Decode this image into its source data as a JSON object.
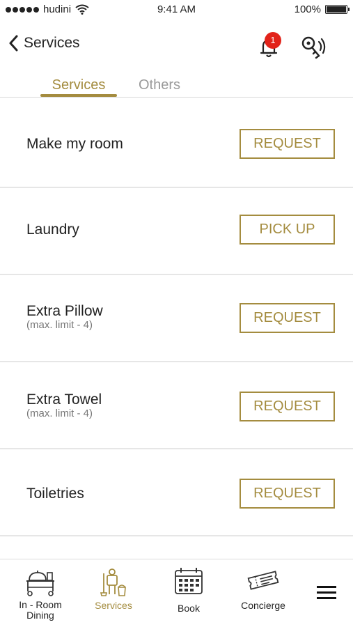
{
  "status_bar": {
    "carrier": "hudini",
    "time": "9:41 AM",
    "battery": "100%"
  },
  "header": {
    "back_label": "Services",
    "notification_count": "1"
  },
  "tabs": [
    {
      "label": "Services",
      "active": true
    },
    {
      "label": "Others",
      "active": false
    }
  ],
  "services": [
    {
      "title": "Make my room",
      "subtitle": "",
      "action": "REQUEST"
    },
    {
      "title": "Laundry",
      "subtitle": "",
      "action": "PICK UP"
    },
    {
      "title": "Extra Pillow",
      "subtitle": "(max. limit - 4)",
      "action": "REQUEST"
    },
    {
      "title": "Extra Towel",
      "subtitle": "(max. limit - 4)",
      "action": "REQUEST"
    },
    {
      "title": "Toiletries",
      "subtitle": "",
      "action": "REQUEST"
    }
  ],
  "bottom_nav": [
    {
      "label": "In - Room Dining",
      "icon": "room-service-cart-icon"
    },
    {
      "label": "Services",
      "icon": "housekeeping-icon",
      "active": true
    },
    {
      "label": "Book",
      "icon": "calendar-icon"
    },
    {
      "label": "Concierge",
      "icon": "ticket-icon"
    },
    {
      "label": "",
      "icon": "menu-icon"
    }
  ],
  "colors": {
    "accent": "#a48c3f",
    "badge": "#e2231a",
    "divider": "#e6e6e6"
  }
}
